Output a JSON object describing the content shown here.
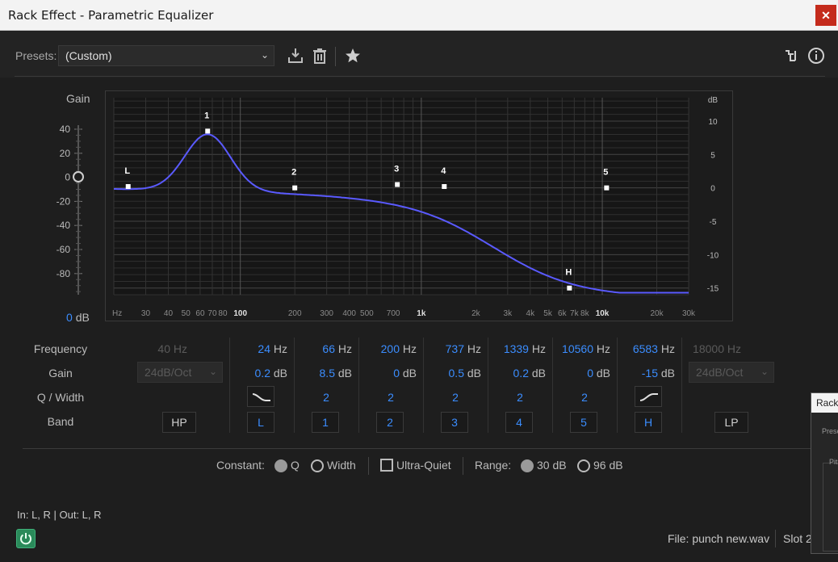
{
  "window": {
    "title": "Rack Effect - Parametric Equalizer",
    "close_glyph": "✕"
  },
  "presets": {
    "label": "Presets:",
    "selected": "(Custom)",
    "icons": [
      "save-preset-icon",
      "delete-preset-icon",
      "favorite-star-icon",
      "routing-icon",
      "info-icon"
    ]
  },
  "gain": {
    "title": "Gain",
    "value": "0",
    "unit": "dB",
    "scale": [
      "40",
      "20",
      "0",
      "-20",
      "-40",
      "-60",
      "-80"
    ]
  },
  "graph": {
    "db_axis_label": "dB",
    "db_ticks": [
      "10",
      "5",
      "0",
      "-5",
      "-10",
      "-15"
    ],
    "freq_ticks": [
      "Hz",
      "30",
      "40",
      "50",
      "60",
      "70",
      "80",
      "100",
      "200",
      "300",
      "400",
      "500",
      "700",
      "1k",
      "2k",
      "3k",
      "4k",
      "5k",
      "6k",
      "7k",
      "8k",
      "10k",
      "20k",
      "30k"
    ],
    "curve_color": "#5a5aff",
    "points": [
      "L",
      "1",
      "2",
      "3",
      "4",
      "5",
      "H"
    ]
  },
  "bands": {
    "row_labels": {
      "frequency": "Frequency",
      "gain": "Gain",
      "q": "Q / Width",
      "band": "Band"
    },
    "hp": {
      "freq": "40",
      "unit": "Hz",
      "slope": "24dB/Oct",
      "button": "HP"
    },
    "lp": {
      "freq": "18000",
      "unit": "Hz",
      "slope": "24dB/Oct",
      "button": "LP"
    },
    "columns": [
      {
        "freq": "24",
        "freq_unit": "Hz",
        "gain": "0.2",
        "gain_unit": "dB",
        "q": "",
        "button": "L"
      },
      {
        "freq": "66",
        "freq_unit": "Hz",
        "gain": "8.5",
        "gain_unit": "dB",
        "q": "2",
        "button": "1"
      },
      {
        "freq": "200",
        "freq_unit": "Hz",
        "gain": "0",
        "gain_unit": "dB",
        "q": "2",
        "button": "2"
      },
      {
        "freq": "737",
        "freq_unit": "Hz",
        "gain": "0.5",
        "gain_unit": "dB",
        "q": "2",
        "button": "3"
      },
      {
        "freq": "1339",
        "freq_unit": "Hz",
        "gain": "0.2",
        "gain_unit": "dB",
        "q": "2",
        "button": "4"
      },
      {
        "freq": "10560",
        "freq_unit": "Hz",
        "gain": "0",
        "gain_unit": "dB",
        "q": "2",
        "button": "5"
      },
      {
        "freq": "6583",
        "freq_unit": "Hz",
        "gain": "-15",
        "gain_unit": "dB",
        "q": "",
        "button": "H"
      }
    ]
  },
  "options": {
    "constant_label": "Constant:",
    "q_label": "Q",
    "width_label": "Width",
    "ultra_quiet_label": "Ultra-Quiet",
    "range_label": "Range:",
    "range_30": "30 dB",
    "range_96": "96 dB"
  },
  "footer": {
    "io": "In: L, R | Out: L, R",
    "file": "File: punch new.wav",
    "slot": "Slot 2"
  },
  "peek_window": {
    "title": "Rack E",
    "label1": "Prese",
    "label2": "Pit"
  },
  "colors": {
    "accent": "#3b8dff",
    "background": "#1e1e1e",
    "power_on": "#2a8a5a",
    "close_red": "#c42b1c"
  }
}
